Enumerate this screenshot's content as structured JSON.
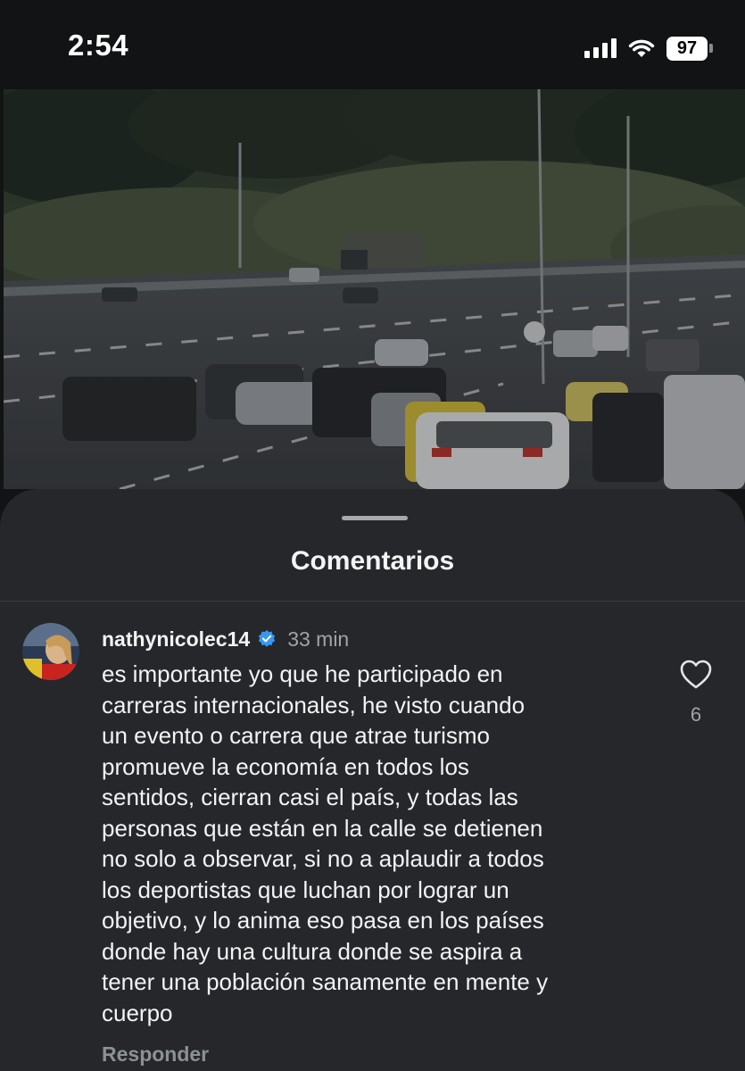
{
  "status_bar": {
    "time": "2:54",
    "battery_level": "97",
    "icons": [
      "cellular-signal-icon",
      "wifi-icon",
      "battery-icon"
    ]
  },
  "video": {
    "description_icon": "traffic-video-frame"
  },
  "comments_sheet": {
    "title": "Comentarios",
    "comments": [
      {
        "username": "nathynicolec14",
        "verified": true,
        "time_ago": "33 min",
        "text": "es importante yo que he participado en\ncarreras internacionales, he visto cuando\nun evento o carrera que atrae turismo\npromueve la economía en todos los\nsentidos, cierran casi el país, y todas las\npersonas que están en la calle se detienen\nno solo a observar, si no a aplaudir a todos\nlos deportistas que luchan por lograr un\nobjetivo, y lo anima eso pasa en los países\ndonde hay una cultura donde se aspira a\ntener una población sanamente en mente y\ncuerpo",
        "likes": "6",
        "reply_label": "Responder"
      }
    ]
  },
  "colors": {
    "sheet_background": "#25272b",
    "screen_background": "#121314",
    "verified_badge": "#3897f0",
    "secondary_text": "#a0a3a7"
  }
}
